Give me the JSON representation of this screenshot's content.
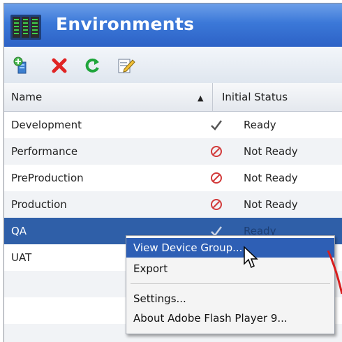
{
  "window": {
    "title": "Environments"
  },
  "toolbar": {
    "buttons": [
      {
        "icon": "add-environment-icon"
      },
      {
        "icon": "delete-icon",
        "color": "#e02424"
      },
      {
        "icon": "refresh-icon",
        "color": "#1fa53b"
      },
      {
        "icon": "edit-icon"
      }
    ]
  },
  "table": {
    "columns": [
      {
        "label": "Name",
        "sort": "ascending"
      },
      {
        "label": "Initial Status"
      }
    ],
    "rows": [
      {
        "name": "Development",
        "status": "Ready",
        "status_icon": "check-icon"
      },
      {
        "name": "Performance",
        "status": "Not Ready",
        "status_icon": "not-allowed-icon"
      },
      {
        "name": "PreProduction",
        "status": "Not Ready",
        "status_icon": "not-allowed-icon"
      },
      {
        "name": "Production",
        "status": "Not Ready",
        "status_icon": "not-allowed-icon"
      },
      {
        "name": "QA",
        "status": "Ready",
        "status_icon": "check-icon",
        "selected": true
      },
      {
        "name": "UAT",
        "status": "",
        "status_icon": ""
      }
    ]
  },
  "context_menu": {
    "items": [
      {
        "label": "View Device Group...",
        "highlighted": true
      },
      {
        "label": "Export"
      },
      {
        "label": "Settings..."
      },
      {
        "label": "About Adobe Flash Player 9..."
      }
    ]
  },
  "colors": {
    "title_bar": "#3b78d8",
    "selection": "#2f5fa8",
    "menu_highlight": "#2e5fb5",
    "not_ready_icon": "#d23a3a",
    "annotation_stroke": "#d81e1e"
  }
}
